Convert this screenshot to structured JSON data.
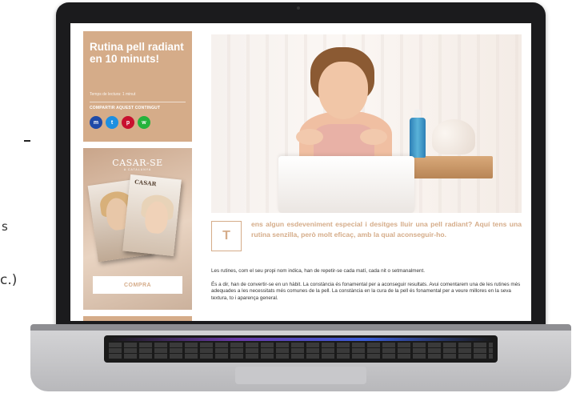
{
  "background": {
    "fragment_1": "s",
    "fragment_2": "c.)"
  },
  "article": {
    "title": "Rutina pell radiant en 10 minuts!",
    "reading_time": "Temps de lectura: 1 minut",
    "share_label": "COMPARTIR AQUEST CONTINGUT",
    "share_buttons": [
      {
        "icon": "messenger-icon",
        "glyph": "m",
        "color": "#1f4aa8"
      },
      {
        "icon": "twitter-icon",
        "glyph": "t",
        "color": "#1d8fe1"
      },
      {
        "icon": "pinterest-icon",
        "glyph": "p",
        "color": "#c8102e"
      },
      {
        "icon": "whatsapp-icon",
        "glyph": "w",
        "color": "#25b33c"
      }
    ],
    "dropcap": "T",
    "intro": "ens algun esdeveniment especial i desitges lluir una pell radiant? Aquí tens una rutina senzilla, però molt eficaç, amb la qual aconseguir-ho.",
    "paragraphs": [
      "Les rutines, com el seu propi nom indica, han de repetir-se cada matí, cada nit o setmanalment.",
      "És a dir, han de convertir-se en un hàbit. La constància és fonamental per a aconseguir resultats. Avui comentarem una de les rutines més adequades a les necessitats més comunes de la pell. La constància en la cura de la pell és fonamental per a veure millores en la seva textura, to i aparença general."
    ]
  },
  "ad": {
    "brand": "CASAR-SE",
    "tagline": "A CATALUNYA",
    "cover_logo": "CASAR",
    "button_label": "COMPRA"
  },
  "colors": {
    "accent": "#d5ac89",
    "body_text": "#333333"
  }
}
